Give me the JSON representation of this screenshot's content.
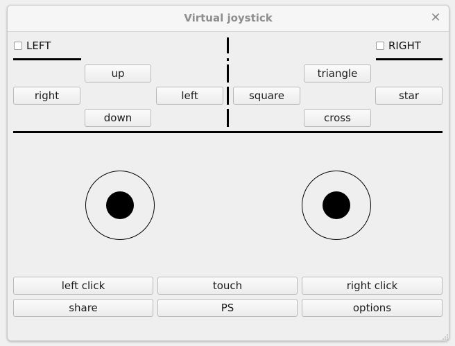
{
  "window": {
    "title": "Virtual joystick"
  },
  "icons": {
    "close": "close-icon",
    "resize": "resize-grip-icon"
  },
  "left_panel": {
    "checkbox_label": "LEFT",
    "checked": false,
    "dpad": {
      "up": "up",
      "right": "right",
      "left": "left",
      "down": "down"
    }
  },
  "right_panel": {
    "checkbox_label": "RIGHT",
    "checked": false,
    "buttons": {
      "square": "square",
      "triangle": "triangle",
      "star": "star",
      "cross": "cross"
    }
  },
  "bottom_buttons": {
    "row1": [
      "left click",
      "touch",
      "right click"
    ],
    "row2": [
      "share",
      "PS",
      "options"
    ]
  },
  "colors": {
    "line": "#000000",
    "knob": "#000000",
    "ring": "#000000"
  }
}
